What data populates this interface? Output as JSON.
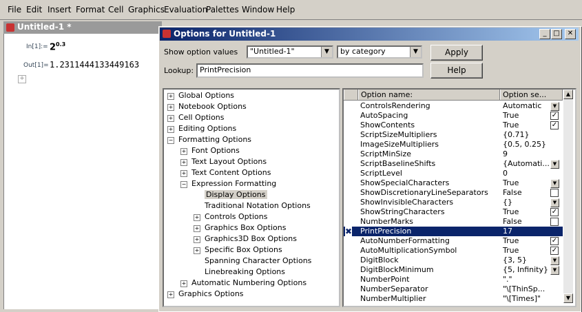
{
  "menubar": [
    "File",
    "Edit",
    "Insert",
    "Format",
    "Cell",
    "Graphics",
    "Evaluation",
    "Palettes",
    "Window",
    "Help"
  ],
  "notebook": {
    "title": "Untitled-1 *",
    "in_label": "In[1]:=",
    "in_expr_base": "2",
    "in_expr_exp": "0.3",
    "out_label": "Out[1]=",
    "out_value": "1.2311444133449163"
  },
  "dialog": {
    "title": "Options for Untitled-1",
    "show_label": "Show option values",
    "scope_value": "\"Untitled-1\"",
    "view_value": "by category",
    "apply": "Apply",
    "lookup_label": "Lookup:",
    "lookup_value": "PrintPrecision",
    "help": "Help",
    "col_name": "Option name:",
    "col_setting": "Option se...",
    "tree": [
      {
        "label": "Global Options",
        "pm": "+"
      },
      {
        "label": "Notebook Options",
        "pm": "+"
      },
      {
        "label": "Cell Options",
        "pm": "+"
      },
      {
        "label": "Editing Options",
        "pm": "+"
      },
      {
        "label": "Formatting Options",
        "pm": "-"
      },
      {
        "label": "Font Options",
        "pm": "+"
      },
      {
        "label": "Text Layout Options",
        "pm": "+"
      },
      {
        "label": "Text Content Options",
        "pm": "+"
      },
      {
        "label": "Expression Formatting",
        "pm": "-"
      },
      {
        "label": "Display Options",
        "pm": ""
      },
      {
        "label": "Traditional Notation Options",
        "pm": ""
      },
      {
        "label": "Controls Options",
        "pm": "+"
      },
      {
        "label": "Graphics Box Options",
        "pm": "+"
      },
      {
        "label": "Graphics3D Box Options",
        "pm": "+"
      },
      {
        "label": "Specific Box Options",
        "pm": "+"
      },
      {
        "label": "Spanning Character Options",
        "pm": ""
      },
      {
        "label": "Linebreaking Options",
        "pm": ""
      },
      {
        "label": "Automatic Numbering Options",
        "pm": "+"
      },
      {
        "label": "Graphics Options",
        "pm": "+"
      }
    ],
    "options": [
      {
        "name": "ControlsRendering",
        "value": "Automatic",
        "ctl": "dd"
      },
      {
        "name": "AutoSpacing",
        "value": "True",
        "ctl": "cbx"
      },
      {
        "name": "ShowContents",
        "value": "True",
        "ctl": "cbx"
      },
      {
        "name": "ScriptSizeMultipliers",
        "value": "{0.71}",
        "ctl": ""
      },
      {
        "name": "ImageSizeMultipliers",
        "value": "{0.5, 0.25}",
        "ctl": ""
      },
      {
        "name": "ScriptMinSize",
        "value": "9",
        "ctl": ""
      },
      {
        "name": "ScriptBaselineShifts",
        "value": "{Automati...",
        "ctl": "dd"
      },
      {
        "name": "ScriptLevel",
        "value": "0",
        "ctl": ""
      },
      {
        "name": "ShowSpecialCharacters",
        "value": "True",
        "ctl": "dd"
      },
      {
        "name": "ShowDiscretionaryLineSeparators",
        "value": "False",
        "ctl": "cb"
      },
      {
        "name": "ShowInvisibleCharacters",
        "value": "{}",
        "ctl": "dd"
      },
      {
        "name": "ShowStringCharacters",
        "value": "True",
        "ctl": "cbx"
      },
      {
        "name": "NumberMarks",
        "value": "False",
        "ctl": "cb"
      },
      {
        "name": "PrintPrecision",
        "value": "17",
        "ctl": ""
      },
      {
        "name": "AutoNumberFormatting",
        "value": "True",
        "ctl": "cbx"
      },
      {
        "name": "AutoMultiplicationSymbol",
        "value": "True",
        "ctl": "cbx"
      },
      {
        "name": "DigitBlock",
        "value": "{3, 5}",
        "ctl": "dd"
      },
      {
        "name": "DigitBlockMinimum",
        "value": "{5, Infinity}",
        "ctl": "dd"
      },
      {
        "name": "NumberPoint",
        "value": "\".\"",
        "ctl": ""
      },
      {
        "name": "NumberSeparator",
        "value": "\"\\[ThinSp...",
        "ctl": ""
      },
      {
        "name": "NumberMultiplier",
        "value": "\"\\[Times]\"",
        "ctl": ""
      }
    ],
    "selected_option": "PrintPrecision"
  }
}
